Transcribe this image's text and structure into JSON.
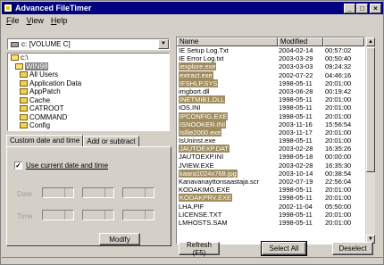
{
  "app": {
    "title": "Advanced FileTimer"
  },
  "menu": [
    {
      "label": "File",
      "key": "F",
      "rest": "ile"
    },
    {
      "label": "View",
      "key": "V",
      "rest": "iew"
    },
    {
      "label": "Help",
      "key": "H",
      "rest": "elp"
    }
  ],
  "drive": {
    "value": "c: [VOLUME C]"
  },
  "tree": [
    {
      "label": "c:\\",
      "indent": 0,
      "open": true,
      "selected": false
    },
    {
      "label": "WIN98",
      "indent": 1,
      "open": true,
      "selected": true
    },
    {
      "label": "All Users",
      "indent": 2,
      "open": false,
      "selected": false
    },
    {
      "label": "Application Data",
      "indent": 2,
      "open": false,
      "selected": false
    },
    {
      "label": "AppPatch",
      "indent": 2,
      "open": false,
      "selected": false
    },
    {
      "label": "Cache",
      "indent": 2,
      "open": false,
      "selected": false
    },
    {
      "label": "CATROOT",
      "indent": 2,
      "open": false,
      "selected": false
    },
    {
      "label": "COMMAND",
      "indent": 2,
      "open": false,
      "selected": false
    },
    {
      "label": "Config",
      "indent": 2,
      "open": false,
      "selected": false
    }
  ],
  "tabs": [
    {
      "label": "Custom date and time",
      "active": true
    },
    {
      "label": "Add or subtract",
      "active": false
    }
  ],
  "options": {
    "use_current_label": "Use current date and time",
    "use_current_checked": "✓",
    "date_label": "Date",
    "time_label": "Time"
  },
  "buttons": {
    "modify": "Modify",
    "refresh": "Refresh (F5)",
    "select_all": "Select All",
    "deselect": "Deselect"
  },
  "filelist": {
    "columns": [
      "Name",
      "Modified",
      ""
    ],
    "rows": [
      {
        "name": "IE Setup Log.Txt",
        "date": "2004-02-14",
        "time": "00:57:02",
        "hi": false
      },
      {
        "name": "IE Error Log.txt",
        "date": "2003-03-29",
        "time": "00:50:40",
        "hi": false
      },
      {
        "name": "iexplore.exe",
        "date": "2003-03-03",
        "time": "09:24:32",
        "hi": true
      },
      {
        "name": "extract.exe",
        "date": "2002-07-22",
        "time": "04:46:16",
        "hi": true
      },
      {
        "name": "IFSHLP.SYS",
        "date": "1998-05-11",
        "time": "20:01:00",
        "hi": true
      },
      {
        "name": "imgbort.dll",
        "date": "2003-06-28",
        "time": "00:19:42",
        "hi": false
      },
      {
        "name": "INETMIB1.DLL",
        "date": "1998-05-11",
        "time": "20:01:00",
        "hi": true
      },
      {
        "name": "IOS.INI",
        "date": "1998-05-11",
        "time": "20:01:00",
        "hi": false
      },
      {
        "name": "IPCONFIG.EXE",
        "date": "1998-05-11",
        "time": "20:01:00",
        "hi": true
      },
      {
        "name": "ISNOOKER.INI",
        "date": "2003-11-16",
        "time": "15:56:54",
        "hi": true
      },
      {
        "name": "Isfile2000.exe",
        "date": "2003-11-17",
        "time": "20:01:00",
        "hi": true
      },
      {
        "name": "IsUninst.exe",
        "date": "1998-05-11",
        "time": "20:01:00",
        "hi": false
      },
      {
        "name": "JAUTOEXP.DAT",
        "date": "2003-02-28",
        "time": "16:35:26",
        "hi": true
      },
      {
        "name": "JAUTOEXP.INI",
        "date": "1998-05-18",
        "time": "00:00:00",
        "hi": false
      },
      {
        "name": "JVIEW.EXE",
        "date": "2003-02-28",
        "time": "16:35:30",
        "hi": false
      },
      {
        "name": "kaara1024x768.jpg",
        "date": "2003-10-14",
        "time": "00:38:54",
        "hi": true
      },
      {
        "name": "Kanavanayttonsaastaja.scr",
        "date": "2002-07-19",
        "time": "22:56:04",
        "hi": false
      },
      {
        "name": "KODAKIMG.EXE",
        "date": "1998-05-11",
        "time": "20:01:00",
        "hi": false
      },
      {
        "name": "KODAKPRV.EXE",
        "date": "1998-05-11",
        "time": "20:01:00",
        "hi": true
      },
      {
        "name": "LHA.PIF",
        "date": "2002-11-04",
        "time": "05:50:00",
        "hi": false
      },
      {
        "name": "LICENSE.TXT",
        "date": "1998-05-11",
        "time": "20:01:00",
        "hi": false
      },
      {
        "name": "LMHOSTS.SAM",
        "date": "1998-05-11",
        "time": "20:01:00",
        "hi": false
      }
    ]
  }
}
